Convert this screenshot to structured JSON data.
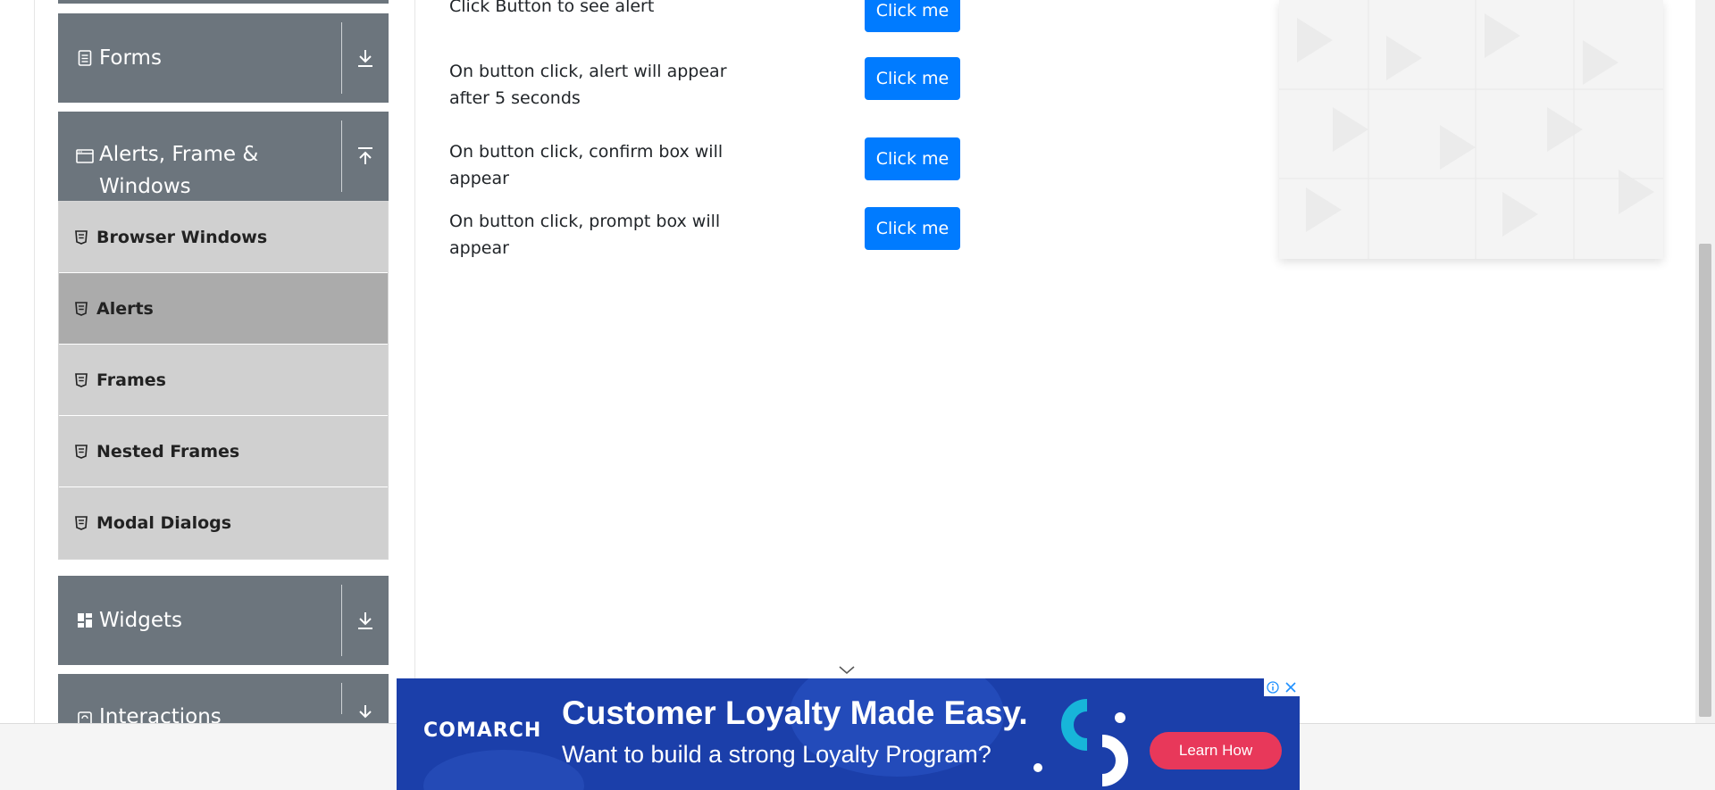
{
  "sidebar": {
    "groups": {
      "forms": {
        "label": "Forms",
        "icon": "form-icon",
        "arrow": "download-arrow-icon"
      },
      "alerts": {
        "label": "Alerts, Frame & Windows",
        "icon": "window-icon",
        "arrow": "upload-arrow-icon"
      },
      "widgets": {
        "label": "Widgets",
        "icon": "widgets-icon",
        "arrow": "download-arrow-icon"
      },
      "interactions": {
        "label": "Interactions",
        "icon": "interactions-icon",
        "arrow": "download-arrow-icon"
      }
    },
    "items": [
      {
        "label": "Browser Windows",
        "active": false
      },
      {
        "label": "Alerts",
        "active": true
      },
      {
        "label": "Frames",
        "active": false
      },
      {
        "label": "Nested Frames",
        "active": false
      },
      {
        "label": "Modal Dialogs",
        "active": false
      }
    ]
  },
  "main": {
    "rows": [
      {
        "text": "Click Button to see alert",
        "button": "Click me"
      },
      {
        "text": "On button click, alert will appear after 5 seconds",
        "button": "Click me"
      },
      {
        "text": "On button click, confirm box will appear",
        "button": "Click me"
      },
      {
        "text": "On button click, prompt box will appear",
        "button": "Click me"
      }
    ]
  },
  "ad": {
    "brand": "COMARCH",
    "headline": "Customer Loyalty Made Easy.",
    "subline": "Want to build a strong Loyalty Program?",
    "cta": "Learn How"
  },
  "colors": {
    "sidebar_header": "#6c757d",
    "menu_item": "#d0d0d0",
    "menu_item_active": "#ababab",
    "primary_button": "#007bff",
    "ad_background": "#1b3faa",
    "ad_cta": "#e8385a"
  }
}
